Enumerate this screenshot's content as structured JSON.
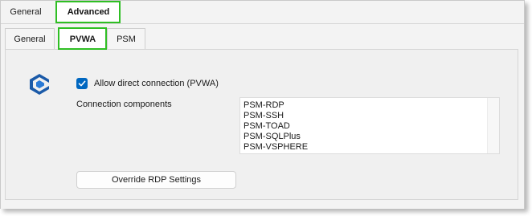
{
  "top_tabs": {
    "general_label": "General",
    "advanced_label": "Advanced"
  },
  "inner_tabs": {
    "general_label": "General",
    "pvwa_label": "PVWA",
    "psm_label": "PSM"
  },
  "pvwa": {
    "logo_icon": "cyberark-logo-icon",
    "allow_direct_connection": {
      "label": "Allow direct connection (PVWA)",
      "checked": true
    },
    "connection_components_label": "Connection components",
    "connection_components": [
      "PSM-RDP",
      "PSM-SSH",
      "PSM-TOAD",
      "PSM-SQLPlus",
      "PSM-VSPHERE"
    ],
    "override_button_label": "Override RDP Settings"
  },
  "colors": {
    "highlight": "#2fbf24",
    "checkbox": "#0067c0",
    "logo": "#1b5aa8"
  }
}
